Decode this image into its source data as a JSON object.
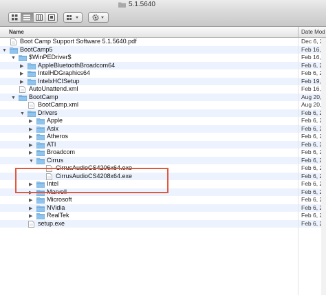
{
  "window": {
    "title": "5.1.5640"
  },
  "toolbar": {
    "view_buttons": [
      "icon-view-icon",
      "list-view-icon",
      "column-view-icon",
      "coverflow-view-icon"
    ],
    "arrange_icon": "arrange-icon",
    "action_icon": "gear-icon"
  },
  "columns": {
    "name": "Name",
    "date": "Date Mod"
  },
  "colors": {
    "folder": "#8ec4ee",
    "highlight": "#e2583e",
    "alt_row": "#edf3fe"
  },
  "rows": [
    {
      "name": "Boot Camp Support Software 5.1.5640.pdf",
      "date": "Dec 6, 2",
      "depth": 0,
      "type": "file",
      "disclosure": ""
    },
    {
      "name": "BootCamp5",
      "date": "Feb 16, 2",
      "depth": 0,
      "type": "folder",
      "disclosure": "open"
    },
    {
      "name": "$WinPEDriver$",
      "date": "Feb 16, 2",
      "depth": 1,
      "type": "folder",
      "disclosure": "open"
    },
    {
      "name": "AppleBluetoothBroadcom64",
      "date": "Feb 6, 20",
      "depth": 2,
      "type": "folder",
      "disclosure": "closed"
    },
    {
      "name": "IntelHDGraphics64",
      "date": "Feb 6, 20",
      "depth": 2,
      "type": "folder",
      "disclosure": "closed"
    },
    {
      "name": "IntelxHCISetup",
      "date": "Feb 19, 2",
      "depth": 2,
      "type": "folder",
      "disclosure": "closed"
    },
    {
      "name": "AutoUnattend.xml",
      "date": "Feb 16, 2",
      "depth": 1,
      "type": "file",
      "disclosure": ""
    },
    {
      "name": "BootCamp",
      "date": "Aug 20,",
      "depth": 1,
      "type": "folder",
      "disclosure": "open"
    },
    {
      "name": "BootCamp.xml",
      "date": "Aug 20,",
      "depth": 2,
      "type": "file",
      "disclosure": ""
    },
    {
      "name": "Drivers",
      "date": "Feb 6, 20",
      "depth": 2,
      "type": "folder",
      "disclosure": "open"
    },
    {
      "name": "Apple",
      "date": "Feb 6, 20",
      "depth": 3,
      "type": "folder",
      "disclosure": "closed"
    },
    {
      "name": "Asix",
      "date": "Feb 6, 20",
      "depth": 3,
      "type": "folder",
      "disclosure": "closed"
    },
    {
      "name": "Atheros",
      "date": "Feb 6, 20",
      "depth": 3,
      "type": "folder",
      "disclosure": "closed"
    },
    {
      "name": "ATI",
      "date": "Feb 6, 20",
      "depth": 3,
      "type": "folder",
      "disclosure": "closed"
    },
    {
      "name": "Broadcom",
      "date": "Feb 6, 20",
      "depth": 3,
      "type": "folder",
      "disclosure": "closed"
    },
    {
      "name": "Cirrus",
      "date": "Feb 6, 20",
      "depth": 3,
      "type": "folder",
      "disclosure": "open"
    },
    {
      "name": "CirrusAudioCS4206x64.exe",
      "date": "Feb 6, 20",
      "depth": 4,
      "type": "file",
      "disclosure": ""
    },
    {
      "name": "CirrusAudioCS4208x64.exe",
      "date": "Feb 6, 20",
      "depth": 4,
      "type": "file",
      "disclosure": ""
    },
    {
      "name": "Intel",
      "date": "Feb 6, 20",
      "depth": 3,
      "type": "folder",
      "disclosure": "closed"
    },
    {
      "name": "Marvell",
      "date": "Feb 6, 20",
      "depth": 3,
      "type": "folder",
      "disclosure": "closed"
    },
    {
      "name": "Microsoft",
      "date": "Feb 6, 20",
      "depth": 3,
      "type": "folder",
      "disclosure": "closed"
    },
    {
      "name": "NVidia",
      "date": "Feb 6, 20",
      "depth": 3,
      "type": "folder",
      "disclosure": "closed"
    },
    {
      "name": "RealTek",
      "date": "Feb 6, 20",
      "depth": 3,
      "type": "folder",
      "disclosure": "closed"
    },
    {
      "name": "setup.exe",
      "date": "Feb 6, 20",
      "depth": 2,
      "type": "file",
      "disclosure": ""
    }
  ]
}
